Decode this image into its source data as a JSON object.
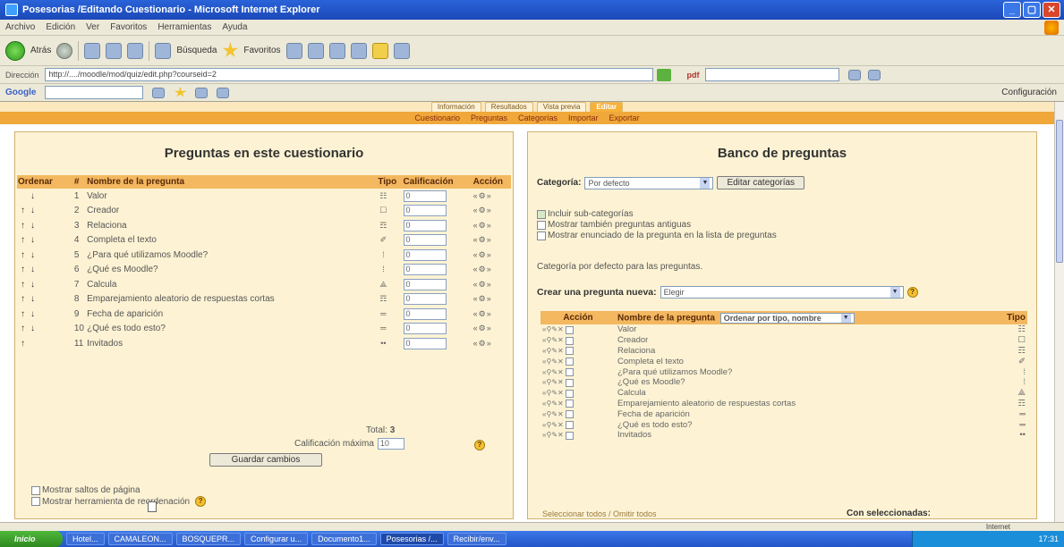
{
  "window": {
    "title": "Posesorias /Editando Cuestionario - Microsoft Internet Explorer",
    "controls": [
      "_",
      "▢",
      "✕"
    ]
  },
  "menubar": {
    "items": [
      "Archivo",
      "Edición",
      "Ver",
      "Favoritos",
      "Herramientas",
      "Ayuda"
    ]
  },
  "toolbar": {
    "back": "Atrás",
    "search": "Búsqueda",
    "favorites": "Favoritos"
  },
  "address": {
    "label": "Dirección",
    "url": "http://..../moodle/mod/quiz/edit.php?courseid=2",
    "pdf": "pdf"
  },
  "googlebar": {
    "label": "Google",
    "settings": "Configuración"
  },
  "moodle": {
    "tabs": [
      "Información",
      "Resultados",
      "Vista previa",
      "Editar"
    ],
    "active_tab": "Editar",
    "subtabs": [
      "Cuestionario",
      "Preguntas",
      "Categorías",
      "Importar",
      "Exportar"
    ]
  },
  "left": {
    "title": "Preguntas en este cuestionario",
    "headers": [
      "Ordenar",
      "#",
      "Nombre de la pregunta",
      "Tipo",
      "Calificación",
      "Acción"
    ],
    "rows": [
      {
        "num": "1",
        "name": "Valor",
        "tipo": "☷",
        "grade": "0",
        "up": false,
        "down": true
      },
      {
        "num": "2",
        "name": "Creador",
        "tipo": "☐",
        "grade": "0",
        "up": true,
        "down": true
      },
      {
        "num": "3",
        "name": "Relaciona",
        "tipo": "☶",
        "grade": "0",
        "up": true,
        "down": true
      },
      {
        "num": "4",
        "name": "Completa el texto",
        "tipo": "✐",
        "grade": "0",
        "up": true,
        "down": true
      },
      {
        "num": "5",
        "name": "¿Para qué utilizamos Moodle?",
        "tipo": "⁞",
        "grade": "0",
        "up": true,
        "down": true
      },
      {
        "num": "6",
        "name": "¿Qué es Moodle?",
        "tipo": "⁞",
        "grade": "0",
        "up": true,
        "down": true
      },
      {
        "num": "7",
        "name": "Calcula",
        "tipo": "⟁",
        "grade": "0",
        "up": true,
        "down": true
      },
      {
        "num": "8",
        "name": "Emparejamiento aleatorio de respuestas cortas",
        "tipo": "☶",
        "grade": "0",
        "up": true,
        "down": true
      },
      {
        "num": "9",
        "name": "Fecha de aparición",
        "tipo": "═",
        "grade": "0",
        "up": true,
        "down": true
      },
      {
        "num": "10",
        "name": "¿Qué es todo esto?",
        "tipo": "═",
        "grade": "0",
        "up": true,
        "down": true
      },
      {
        "num": "11",
        "name": "Invitados",
        "tipo": "••",
        "grade": "0",
        "up": true,
        "down": false
      }
    ],
    "total_label": "Total:",
    "total_value": "3",
    "max_grade_label": "Calificación máxima",
    "max_grade_value": "10",
    "save_button": "Guardar cambios",
    "show_page_breaks": "Mostrar saltos de página",
    "show_reorder_tool": "Mostrar herramienta de reordenación"
  },
  "right": {
    "title": "Banco de preguntas",
    "category_label": "Categoría:",
    "category_value": "Por defecto",
    "edit_categories": "Editar categorías",
    "options": [
      {
        "label": "Incluir sub-categorías",
        "checked": true
      },
      {
        "label": "Mostrar también preguntas antiguas",
        "checked": false
      },
      {
        "label": "Mostrar enunciado de la pregunta en la lista de preguntas",
        "checked": false
      }
    ],
    "default_category_text": "Categoría por defecto para las preguntas.",
    "create_label": "Crear una pregunta nueva:",
    "create_select": "Elegir",
    "headers": {
      "action": "Acción",
      "name": "Nombre de la pregunta",
      "sort": "Ordenar por tipo, nombre",
      "type": "Tipo"
    },
    "rows": [
      {
        "name": "Valor",
        "tipo": "☷"
      },
      {
        "name": "Creador",
        "tipo": "☐"
      },
      {
        "name": "Relaciona",
        "tipo": "☶"
      },
      {
        "name": "Completa el texto",
        "tipo": "✐"
      },
      {
        "name": "¿Para qué utilizamos Moodle?",
        "tipo": "⁞"
      },
      {
        "name": "¿Qué es Moodle?",
        "tipo": "⁞"
      },
      {
        "name": "Calcula",
        "tipo": "⟁"
      },
      {
        "name": "Emparejamiento aleatorio de respuestas cortas",
        "tipo": "☶"
      },
      {
        "name": "Fecha de aparición",
        "tipo": "═"
      },
      {
        "name": "¿Qué es todo esto?",
        "tipo": "═"
      },
      {
        "name": "Invitados",
        "tipo": "••"
      }
    ],
    "select_all": "Seleccionar todos / Omitir todos",
    "with_selected": "Con seleccionadas:"
  },
  "status": {
    "zone": "Internet"
  },
  "taskbar": {
    "start": "Inicio",
    "tasks": [
      "Hotel...",
      "CAMALEON...",
      "BOSQUEPR...",
      "Configurar u...",
      "Documento1...",
      "Posesorias /...",
      "Recibir/env..."
    ],
    "active_task": 5,
    "clock": "17:31"
  },
  "colors": {
    "panel_bg": "#fdf3d4",
    "header_bg": "#f3b860",
    "tab_active": "#f6b13a"
  }
}
